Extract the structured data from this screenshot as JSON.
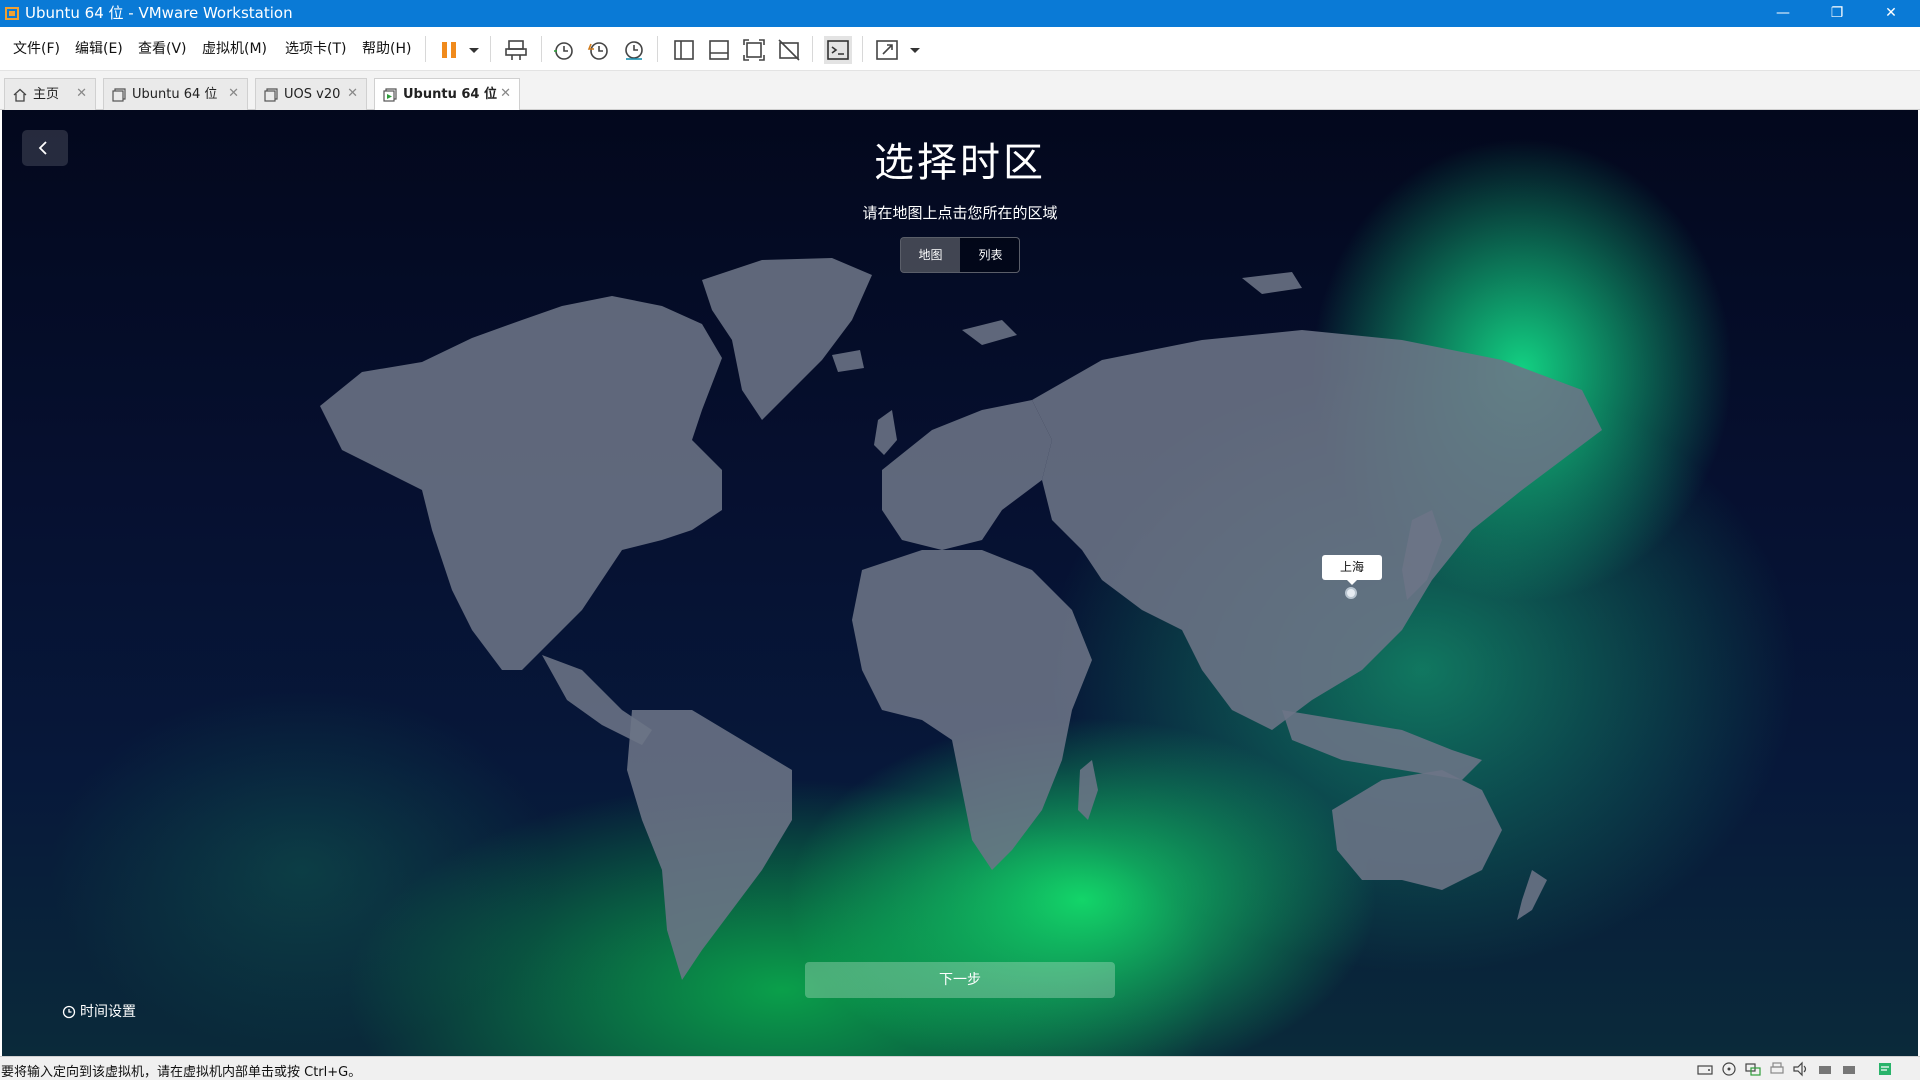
{
  "window": {
    "title": "Ubuntu 64 位 - VMware Workstation",
    "minimize": "—",
    "maximize": "❐",
    "close": "✕"
  },
  "menu": [
    "文件(F)",
    "编辑(E)",
    "查看(V)",
    "虚拟机(M)",
    "选项卡(T)",
    "帮助(H)"
  ],
  "tabs": [
    {
      "label": "主页",
      "icon": "home-icon",
      "active": false
    },
    {
      "label": "Ubuntu 64 位",
      "icon": "vm-icon",
      "active": false
    },
    {
      "label": "UOS v20",
      "icon": "vm-icon",
      "active": false
    },
    {
      "label": "Ubuntu 64 位",
      "icon": "vm-running-icon",
      "active": true
    }
  ],
  "tab_close": "✕",
  "installer": {
    "title": "选择时区",
    "subtitle": "请在地图上点击您所在的区域",
    "view_map": "地图",
    "view_list": "列表",
    "selected_city": "上海",
    "next": "下一步",
    "time_settings": "时间设置"
  },
  "status": {
    "message": "要将输入定向到该虚拟机，请在虚拟机内部单击或按 Ctrl+G。"
  },
  "colors": {
    "title_bar": "#0a7ad6",
    "pause_icon": "#f08a1c",
    "map_land": "#6c7486",
    "glow_green": "#14e66e"
  }
}
